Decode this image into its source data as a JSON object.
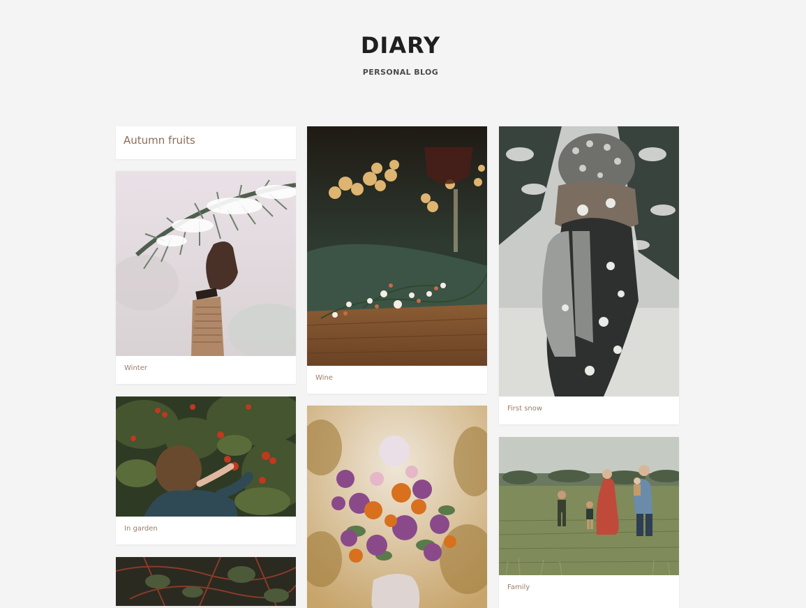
{
  "header": {
    "title": "DIARY",
    "subtitle": "PERSONAL BLOG"
  },
  "posts": [
    {
      "id": "autumn",
      "text": "Autumn fruits"
    },
    {
      "id": "winter",
      "caption": "Winter",
      "image_icon": "pine-branch-glove-photo"
    },
    {
      "id": "wine",
      "caption": "Wine",
      "image_icon": "wine-glass-bokeh-photo"
    },
    {
      "id": "first-snow",
      "caption": "First snow",
      "image_icon": "snowy-person-photo"
    },
    {
      "id": "in-garden",
      "caption": "In garden",
      "image_icon": "girl-berries-photo"
    },
    {
      "id": "flowers",
      "caption": "",
      "image_icon": "flower-bouquet-photo"
    },
    {
      "id": "family",
      "caption": "Family",
      "image_icon": "family-field-photo"
    },
    {
      "id": "leaves",
      "caption": "",
      "image_icon": "leaves-branches-photo"
    }
  ],
  "colors": {
    "background": "#f4f4f4",
    "card": "#ffffff",
    "title": "#1f1f1f",
    "caption": "#9b7c68"
  }
}
